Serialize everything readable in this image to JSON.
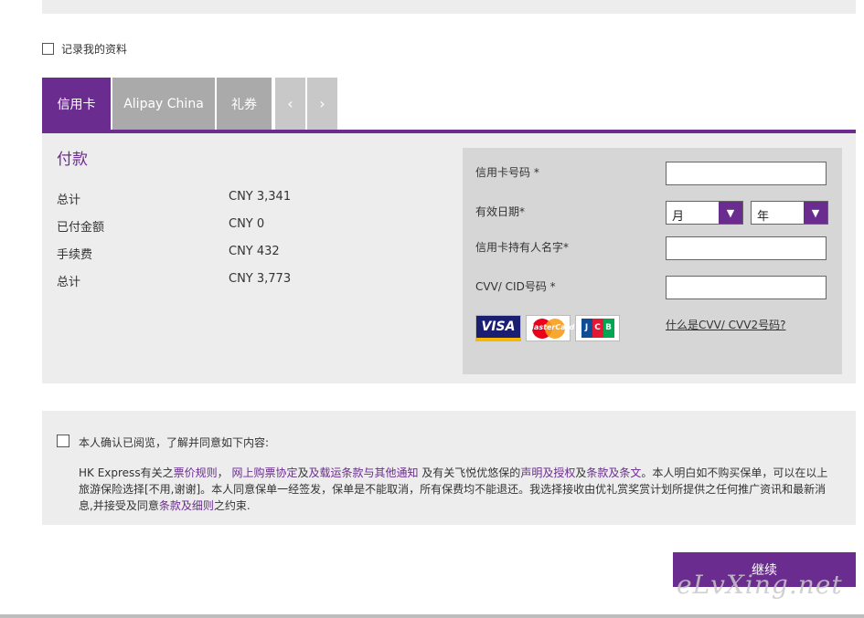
{
  "remember": {
    "label": "记录我的资料"
  },
  "tabs": [
    {
      "label": "信用卡"
    },
    {
      "label": "Alipay China"
    },
    {
      "label": "礼券"
    },
    {
      "label": "‹"
    },
    {
      "label": "›"
    }
  ],
  "payment": {
    "title": "付款",
    "rows": [
      {
        "label": "总计",
        "value": "CNY 3,341"
      },
      {
        "label": "已付金额",
        "value": "CNY 0"
      },
      {
        "label": "手续费",
        "value": "CNY 432"
      },
      {
        "label": "总计",
        "value": "CNY 3,773"
      }
    ]
  },
  "card_form": {
    "card_number_label": "信用卡号码 *",
    "expiry_label": "有效日期*",
    "month_value": "月",
    "year_value": "年",
    "holder_label": "信用卡持有人名字*",
    "cvv_label": "CVV/ CID号码 *",
    "cvv_link": "什么是CVV/ CVV2号码?",
    "cards": {
      "visa": "VISA",
      "mastercard": "MasterCard",
      "jcb": "JCB"
    }
  },
  "terms": {
    "confirm": "本人确认已阅览，了解并同意如下内容:",
    "p1": "HK Express有关之",
    "l1": "票价规则",
    "p2": "，",
    "l2": "网上购票协定",
    "p3": "及",
    "l3": "及载运条款与其他通知",
    "p4": " 及有关飞悦优悠保的",
    "l4": "声明及授权",
    "p5": "及",
    "l5": "条款及条文",
    "p6": "。本人明白如不购买保单，可以在以上旅游保险选择[不用,谢谢]。本人同意保单一经签发，保单是不能取消，所有保费均不能退还。我选择接收由优礼赏奖赏计划所提供之任何推广资讯和最新消息,并接受及同意",
    "l6": "条款及细则",
    "p7": "之约束."
  },
  "continue_label": "继续",
  "watermark": "eLvXing.net",
  "colors": {
    "brand": "#6b2c8f",
    "panel": "#ededed",
    "tab_inactive": "#aaaaaa"
  }
}
